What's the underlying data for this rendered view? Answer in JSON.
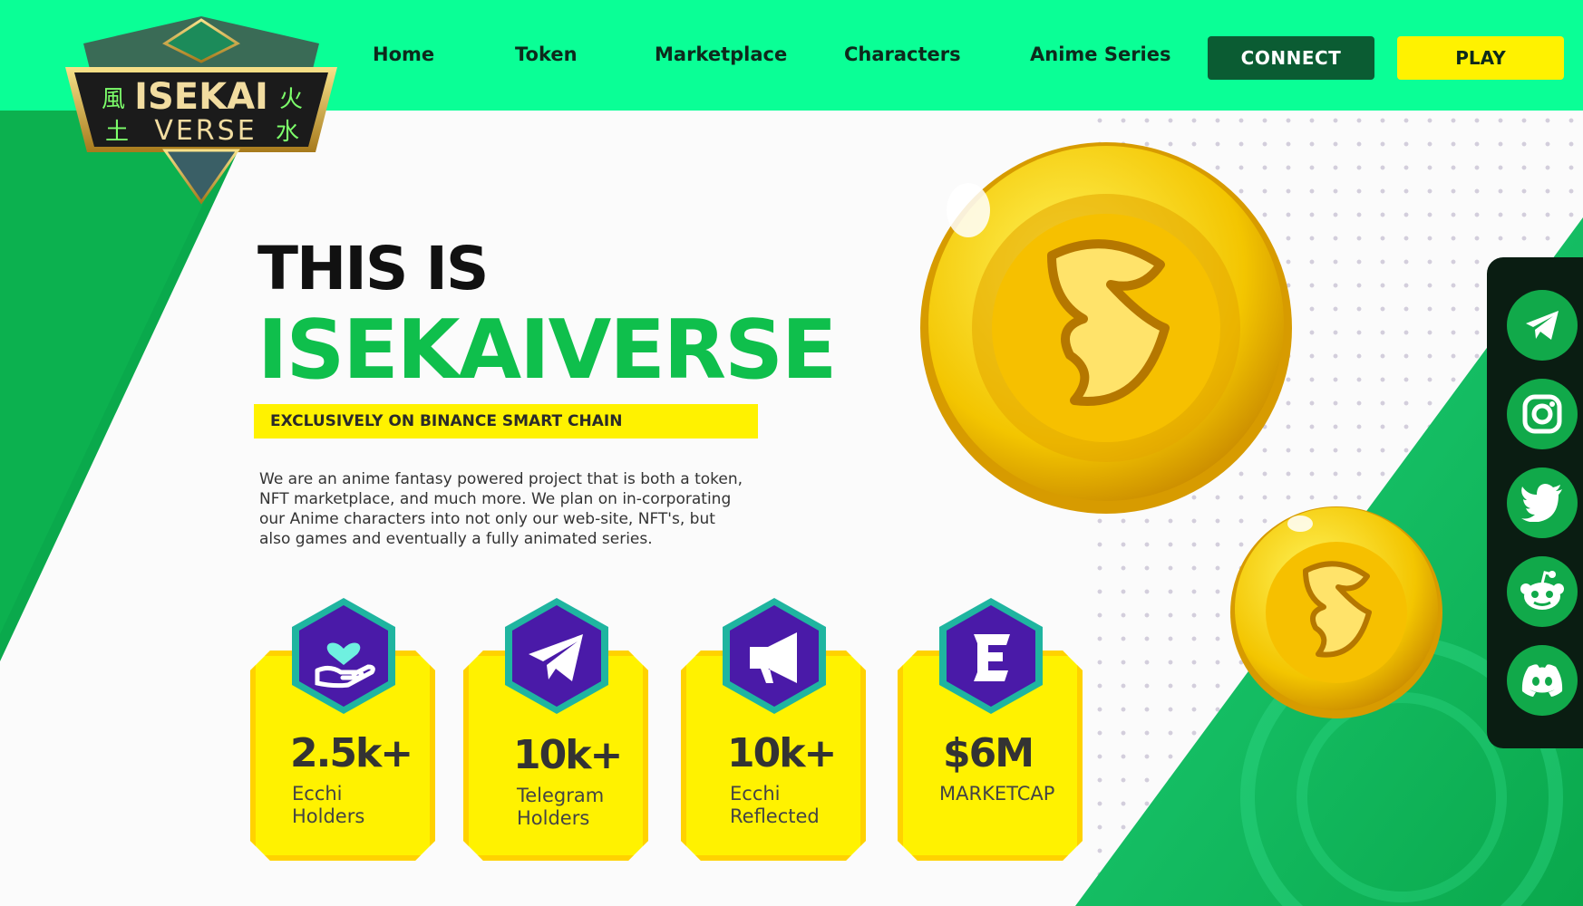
{
  "brand": {
    "logo_top_text": "ISEKAI",
    "logo_bottom_text": "VERSE",
    "logo_kanji": [
      "風",
      "火",
      "土",
      "水"
    ]
  },
  "nav": {
    "items": [
      {
        "label": "Home"
      },
      {
        "label": "Token"
      },
      {
        "label": "Marketplace"
      },
      {
        "label": "Characters"
      },
      {
        "label": "Anime Series"
      }
    ],
    "connect_label": "CONNECT",
    "play_label": "PLAY"
  },
  "hero": {
    "line1": "THIS IS",
    "line2": "ISEKAIVERSE",
    "chain_label": "EXCLUSIVELY ON BINANCE SMART CHAIN",
    "description": "We are an anime fantasy powered project that is both a token, NFT marketplace, and much more. We plan on in-corporating our Anime characters into not only our web-site, NFT's, but also games and eventually a fully animated series."
  },
  "stats": [
    {
      "icon": "heart-hand-icon",
      "value": "2.5k+",
      "label_line1": "Ecchi",
      "label_line2": "Holders"
    },
    {
      "icon": "telegram-icon",
      "value": "10k+",
      "label_line1": "Telegram",
      "label_line2": "Holders"
    },
    {
      "icon": "megaphone-icon",
      "value": "10k+",
      "label_line1": "Ecchi",
      "label_line2": "Reflected"
    },
    {
      "icon": "ecchi-token-icon",
      "value": "$6M",
      "label_line1": "MARKETCAP",
      "label_line2": ""
    }
  ],
  "social": [
    "telegram-icon",
    "instagram-icon",
    "twitter-icon",
    "reddit-icon",
    "discord-icon"
  ],
  "colors": {
    "header_green": "#0aff96",
    "brand_green": "#0fbf4c",
    "dark_green": "#0b5c33",
    "yellow": "#fff200",
    "hex_purple": "#4a1aa8",
    "hex_teal": "#1fb5a0"
  }
}
